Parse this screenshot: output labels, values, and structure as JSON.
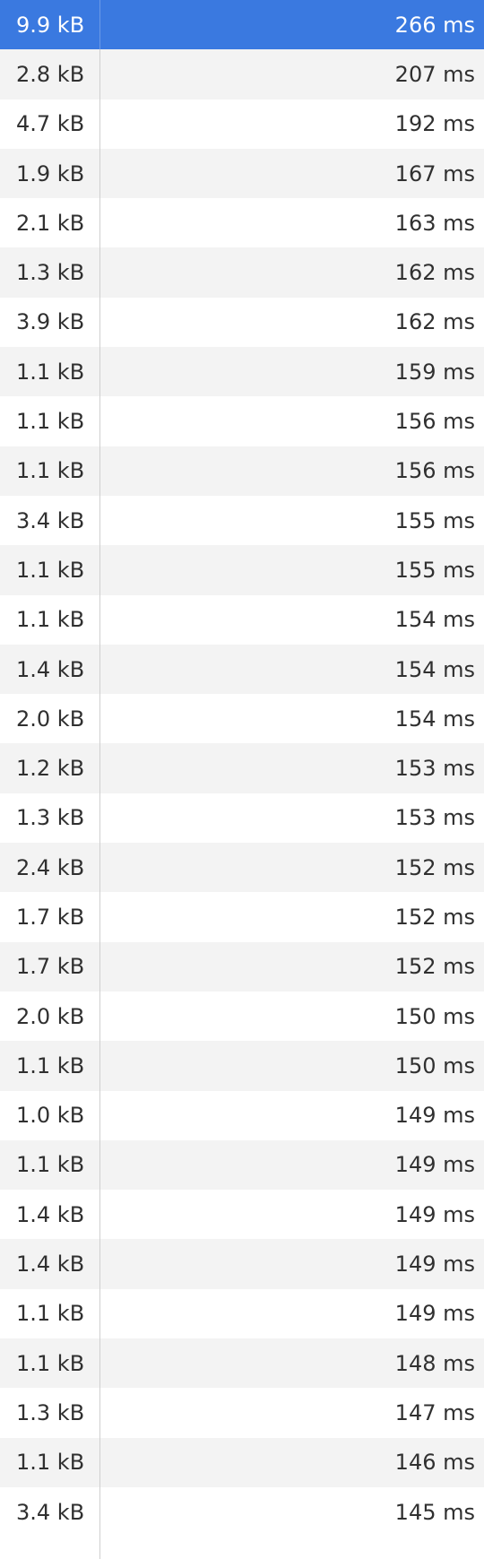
{
  "network_table": {
    "selected_index": 0,
    "rows": [
      {
        "size": "9.9 kB",
        "time": "266 ms"
      },
      {
        "size": "2.8 kB",
        "time": "207 ms"
      },
      {
        "size": "4.7 kB",
        "time": "192 ms"
      },
      {
        "size": "1.9 kB",
        "time": "167 ms"
      },
      {
        "size": "2.1 kB",
        "time": "163 ms"
      },
      {
        "size": "1.3 kB",
        "time": "162 ms"
      },
      {
        "size": "3.9 kB",
        "time": "162 ms"
      },
      {
        "size": "1.1 kB",
        "time": "159 ms"
      },
      {
        "size": "1.1 kB",
        "time": "156 ms"
      },
      {
        "size": "1.1 kB",
        "time": "156 ms"
      },
      {
        "size": "3.4 kB",
        "time": "155 ms"
      },
      {
        "size": "1.1 kB",
        "time": "155 ms"
      },
      {
        "size": "1.1 kB",
        "time": "154 ms"
      },
      {
        "size": "1.4 kB",
        "time": "154 ms"
      },
      {
        "size": "2.0 kB",
        "time": "154 ms"
      },
      {
        "size": "1.2 kB",
        "time": "153 ms"
      },
      {
        "size": "1.3 kB",
        "time": "153 ms"
      },
      {
        "size": "2.4 kB",
        "time": "152 ms"
      },
      {
        "size": "1.7 kB",
        "time": "152 ms"
      },
      {
        "size": "1.7 kB",
        "time": "152 ms"
      },
      {
        "size": "2.0 kB",
        "time": "150 ms"
      },
      {
        "size": "1.1 kB",
        "time": "150 ms"
      },
      {
        "size": "1.0 kB",
        "time": "149 ms"
      },
      {
        "size": "1.1 kB",
        "time": "149 ms"
      },
      {
        "size": "1.4 kB",
        "time": "149 ms"
      },
      {
        "size": "1.4 kB",
        "time": "149 ms"
      },
      {
        "size": "1.1 kB",
        "time": "149 ms"
      },
      {
        "size": "1.1 kB",
        "time": "148 ms"
      },
      {
        "size": "1.3 kB",
        "time": "147 ms"
      },
      {
        "size": "1.1 kB",
        "time": "146 ms"
      },
      {
        "size": "3.4 kB",
        "time": "145 ms"
      }
    ]
  },
  "colors": {
    "selected_row": "#3a79e0",
    "stripe": "#f3f3f3",
    "text": "#303030"
  }
}
